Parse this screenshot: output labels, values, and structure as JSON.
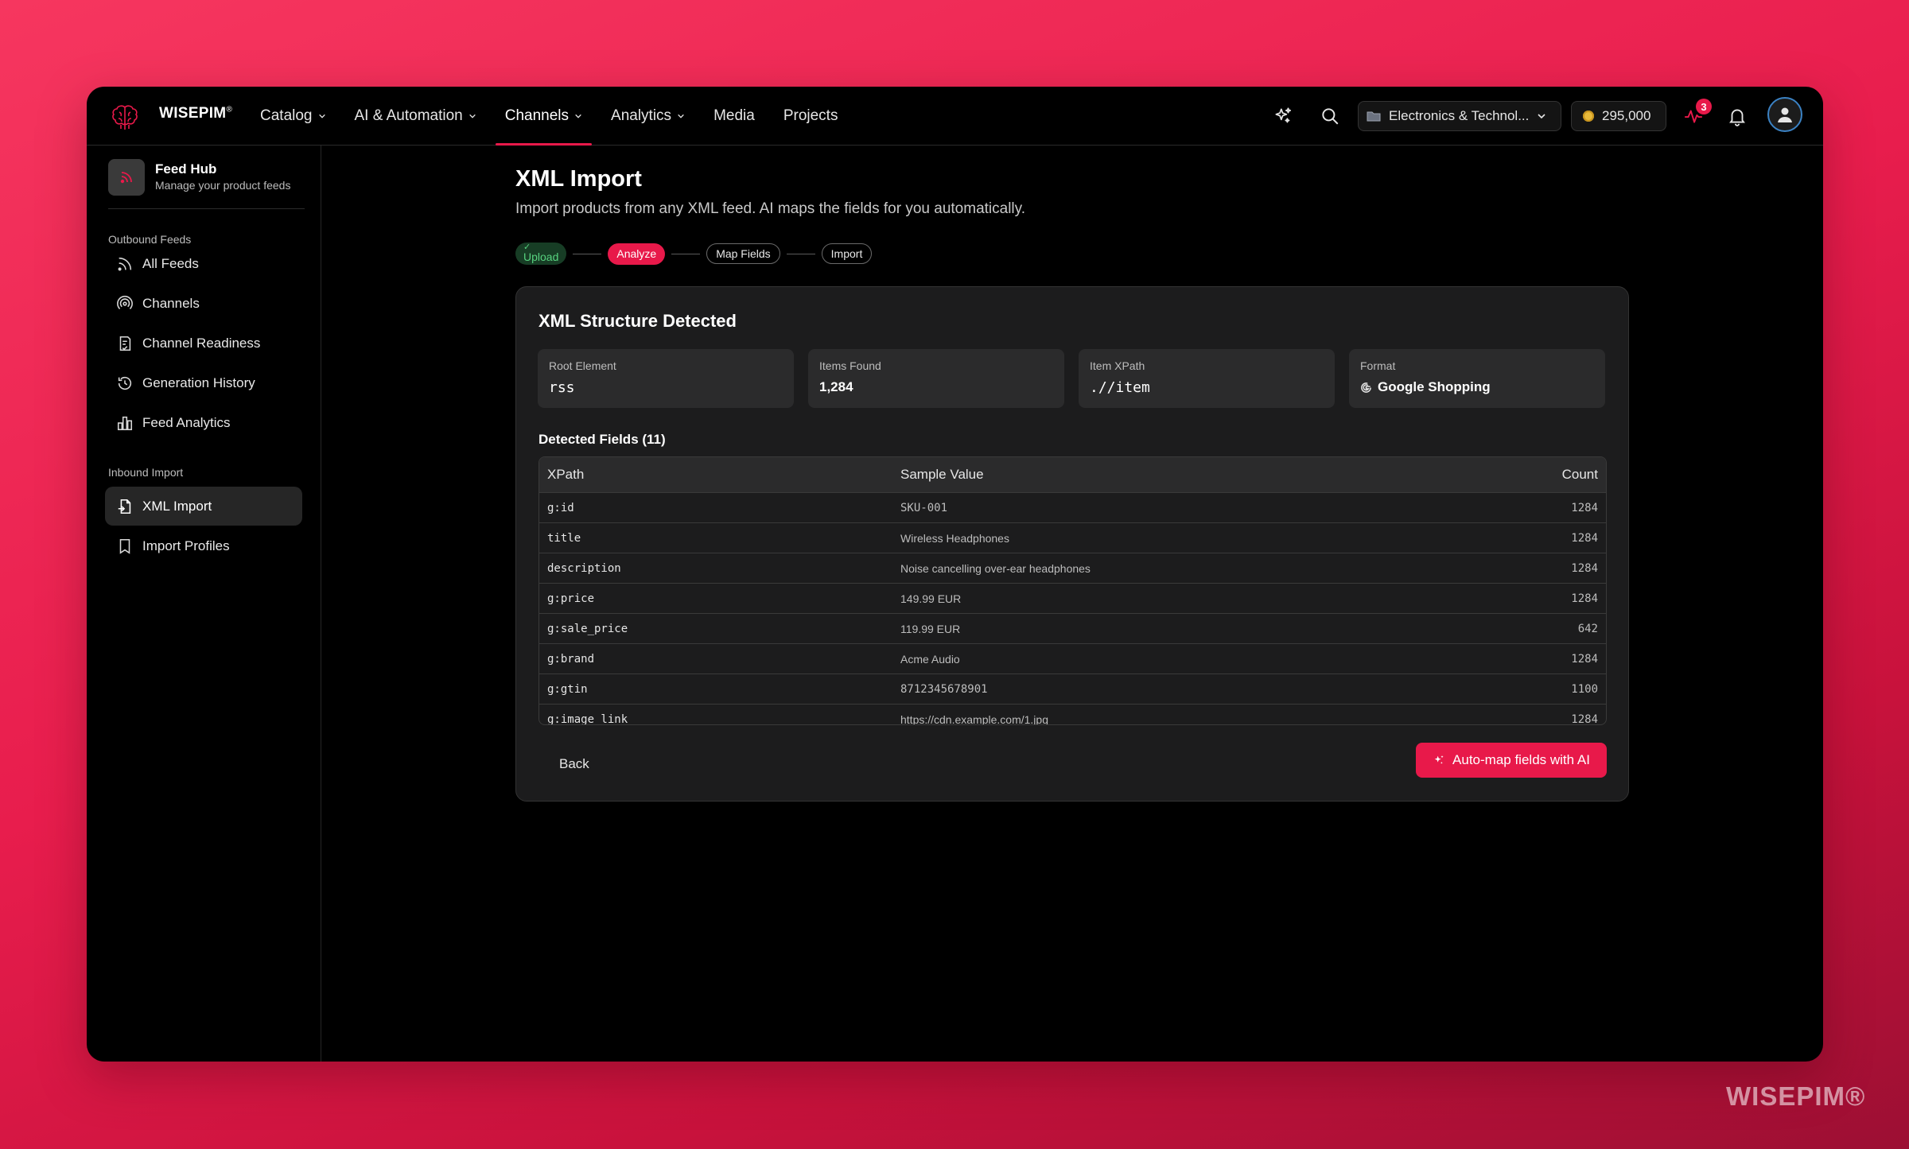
{
  "app": {
    "brand": "WISEPIM",
    "brand_mark": "®",
    "watermark": "WISEPIM®"
  },
  "nav": [
    {
      "label": "Catalog",
      "dropdown": true
    },
    {
      "label": "AI & Automation",
      "dropdown": true
    },
    {
      "label": "Channels",
      "dropdown": true,
      "active": true
    },
    {
      "label": "Analytics",
      "dropdown": true
    },
    {
      "label": "Media",
      "dropdown": false
    },
    {
      "label": "Projects",
      "dropdown": false
    }
  ],
  "topbar": {
    "workspace": "Electronics & Technol...",
    "credits": "295,000",
    "activity_badge": "3"
  },
  "sidebar": {
    "hub_title": "Feed Hub",
    "hub_subtitle": "Manage your product feeds",
    "section_outbound": "Outbound Feeds",
    "outbound": [
      {
        "label": "All Feeds",
        "icon": "rss-icon"
      },
      {
        "label": "Channels",
        "icon": "broadcast-icon"
      },
      {
        "label": "Channel Readiness",
        "icon": "checklist-icon"
      },
      {
        "label": "Generation History",
        "icon": "history-icon"
      },
      {
        "label": "Feed Analytics",
        "icon": "bar-chart-icon"
      }
    ],
    "section_inbound": "Inbound Import",
    "inbound": [
      {
        "label": "XML Import",
        "icon": "file-import-icon",
        "active": true
      },
      {
        "label": "Import Profiles",
        "icon": "bookmark-icon"
      }
    ]
  },
  "page": {
    "title": "XML Import",
    "subtitle": "Import products from any XML feed. AI maps the fields for you automatically."
  },
  "steps": [
    "Upload",
    "Analyze",
    "Map Fields",
    "Import"
  ],
  "card": {
    "title": "XML Structure Detected",
    "stats": [
      {
        "label": "Root Element",
        "value": "rss"
      },
      {
        "label": "Items Found",
        "value": "1,284"
      },
      {
        "label": "Item XPath",
        "value": ".//item"
      },
      {
        "label": "Format",
        "value": "Google Shopping"
      }
    ],
    "fields_heading": "Detected Fields (11)",
    "columns": [
      "XPath",
      "Sample Value",
      "Count"
    ],
    "rows": [
      {
        "xpath": "g:id",
        "sample": "SKU-001",
        "count": "1284"
      },
      {
        "xpath": "title",
        "sample": "Wireless Headphones",
        "count": "1284"
      },
      {
        "xpath": "description",
        "sample": "Noise cancelling over-ear headphones",
        "count": "1284"
      },
      {
        "xpath": "g:price",
        "sample": "149.99 EUR",
        "count": "1284"
      },
      {
        "xpath": "g:sale_price",
        "sample": "119.99 EUR",
        "count": "642"
      },
      {
        "xpath": "g:brand",
        "sample": "Acme Audio",
        "count": "1284"
      },
      {
        "xpath": "g:gtin",
        "sample": "8712345678901",
        "count": "1100"
      },
      {
        "xpath": "g:image_link",
        "sample": "https://cdn.example.com/1.jpg",
        "count": "1284"
      }
    ],
    "back_label": "Back",
    "automap_label": "Auto-map fields with AI"
  },
  "colors": {
    "accent": "#e8194a",
    "success_bg": "#173d25",
    "success_text": "#57d27f"
  }
}
